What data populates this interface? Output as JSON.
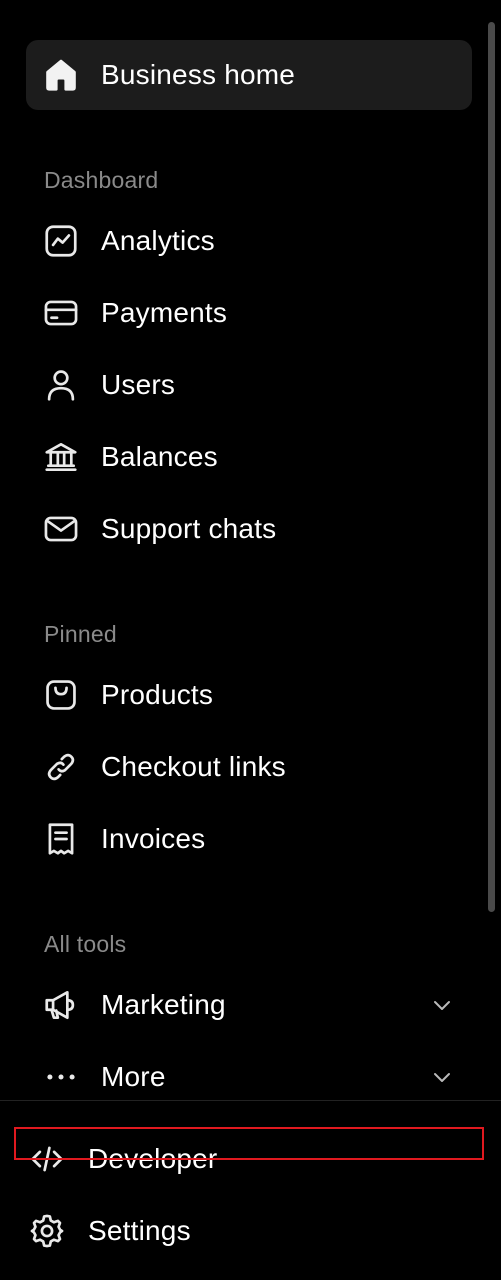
{
  "sidebar": {
    "business_home": {
      "label": "Business home",
      "icon": "home-icon"
    },
    "sections": {
      "dashboard": "Dashboard",
      "pinned": "Pinned",
      "all_tools": "All tools"
    },
    "dashboard_items": [
      {
        "label": "Analytics",
        "icon": "analytics-icon"
      },
      {
        "label": "Payments",
        "icon": "credit-card-icon"
      },
      {
        "label": "Users",
        "icon": "user-icon"
      },
      {
        "label": "Balances",
        "icon": "bank-icon"
      },
      {
        "label": "Support chats",
        "icon": "mail-icon"
      }
    ],
    "pinned_items": [
      {
        "label": "Products",
        "icon": "shopping-bag-icon"
      },
      {
        "label": "Checkout links",
        "icon": "link-icon"
      },
      {
        "label": "Invoices",
        "icon": "receipt-icon"
      }
    ],
    "tool_items": [
      {
        "label": "Marketing",
        "icon": "megaphone-icon",
        "expandable": true
      },
      {
        "label": "More",
        "icon": "more-dots-icon",
        "expandable": true
      }
    ],
    "footer_items": [
      {
        "label": "Developer",
        "icon": "code-icon"
      },
      {
        "label": "Settings",
        "icon": "gear-icon"
      }
    ]
  },
  "colors": {
    "background": "#000000",
    "active_item_bg": "#1c1c1c",
    "section_label": "#8a8a8a",
    "highlight_border": "#e0191f"
  }
}
